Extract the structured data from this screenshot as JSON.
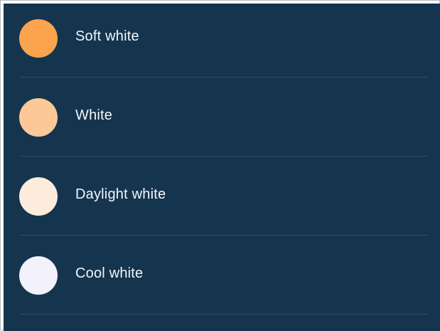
{
  "options": [
    {
      "label": "Soft white",
      "color": "#FBA34D"
    },
    {
      "label": "White",
      "color": "#FCC898"
    },
    {
      "label": "Daylight white",
      "color": "#FDEBDC"
    },
    {
      "label": "Cool white",
      "color": "#F3F1FB"
    }
  ],
  "colors": {
    "background": "#15354F",
    "divider": "#2F4D66",
    "text": "#F4F6F8"
  }
}
